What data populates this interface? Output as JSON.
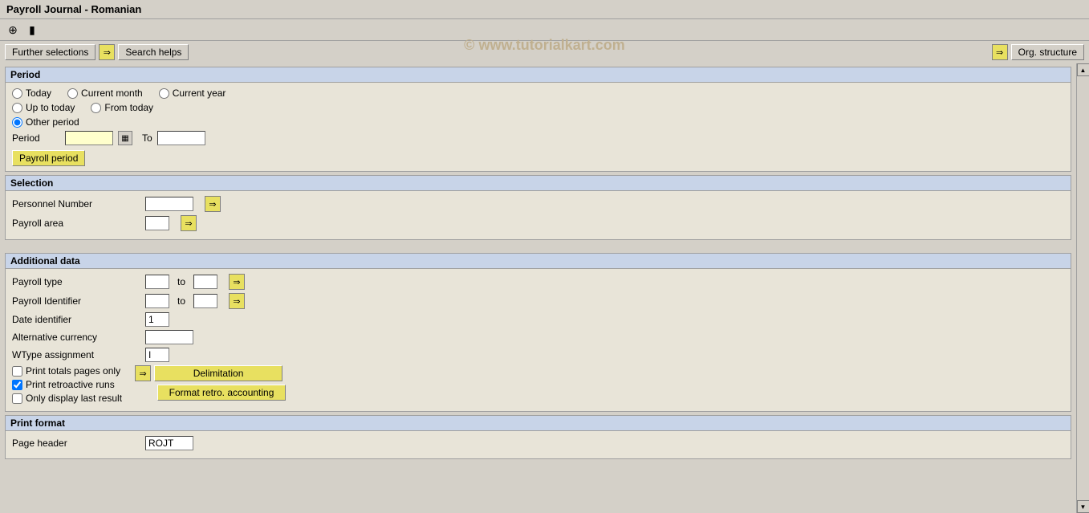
{
  "title": "Payroll Journal - Romanian",
  "watermark": "© www.tutorialkart.com",
  "toolbar": {
    "icons": [
      "⊕",
      "▶"
    ]
  },
  "buttons": {
    "further_selections": "Further selections",
    "search_helps": "Search helps",
    "org_structure": "Org. structure",
    "payroll_period": "Payroll period",
    "delimitation": "Delimitation",
    "format_retro": "Format retro. accounting"
  },
  "sections": {
    "period": {
      "label": "Period",
      "radios": [
        {
          "id": "r_today",
          "label": "Today",
          "checked": false
        },
        {
          "id": "r_current_month",
          "label": "Current month",
          "checked": false
        },
        {
          "id": "r_current_year",
          "label": "Current year",
          "checked": false
        },
        {
          "id": "r_up_to_today",
          "label": "Up to today",
          "checked": false
        },
        {
          "id": "r_from_today",
          "label": "From today",
          "checked": false
        },
        {
          "id": "r_other_period",
          "label": "Other period",
          "checked": true
        }
      ],
      "period_label": "Period",
      "to_label": "To",
      "period_value": "",
      "to_value": ""
    },
    "selection": {
      "label": "Selection",
      "fields": [
        {
          "label": "Personnel Number",
          "value": ""
        },
        {
          "label": "Payroll area",
          "value": ""
        }
      ]
    },
    "additional_data": {
      "label": "Additional data",
      "fields": [
        {
          "label": "Payroll type",
          "value": "",
          "has_to": true,
          "to_value": ""
        },
        {
          "label": "Payroll Identifier",
          "value": "",
          "has_to": true,
          "to_value": ""
        },
        {
          "label": "Date identifier",
          "value": "1",
          "has_to": false
        },
        {
          "label": "Alternative currency",
          "value": "",
          "has_to": false
        },
        {
          "label": "WType assignment",
          "value": "I",
          "has_to": false
        }
      ],
      "checkboxes": [
        {
          "label": "Print totals pages only",
          "checked": false
        },
        {
          "label": "Print retroactive runs",
          "checked": true
        },
        {
          "label": "Only display last result",
          "checked": false
        }
      ]
    },
    "print_format": {
      "label": "Print format",
      "fields": [
        {
          "label": "Page header",
          "value": "ROJT"
        }
      ]
    }
  }
}
